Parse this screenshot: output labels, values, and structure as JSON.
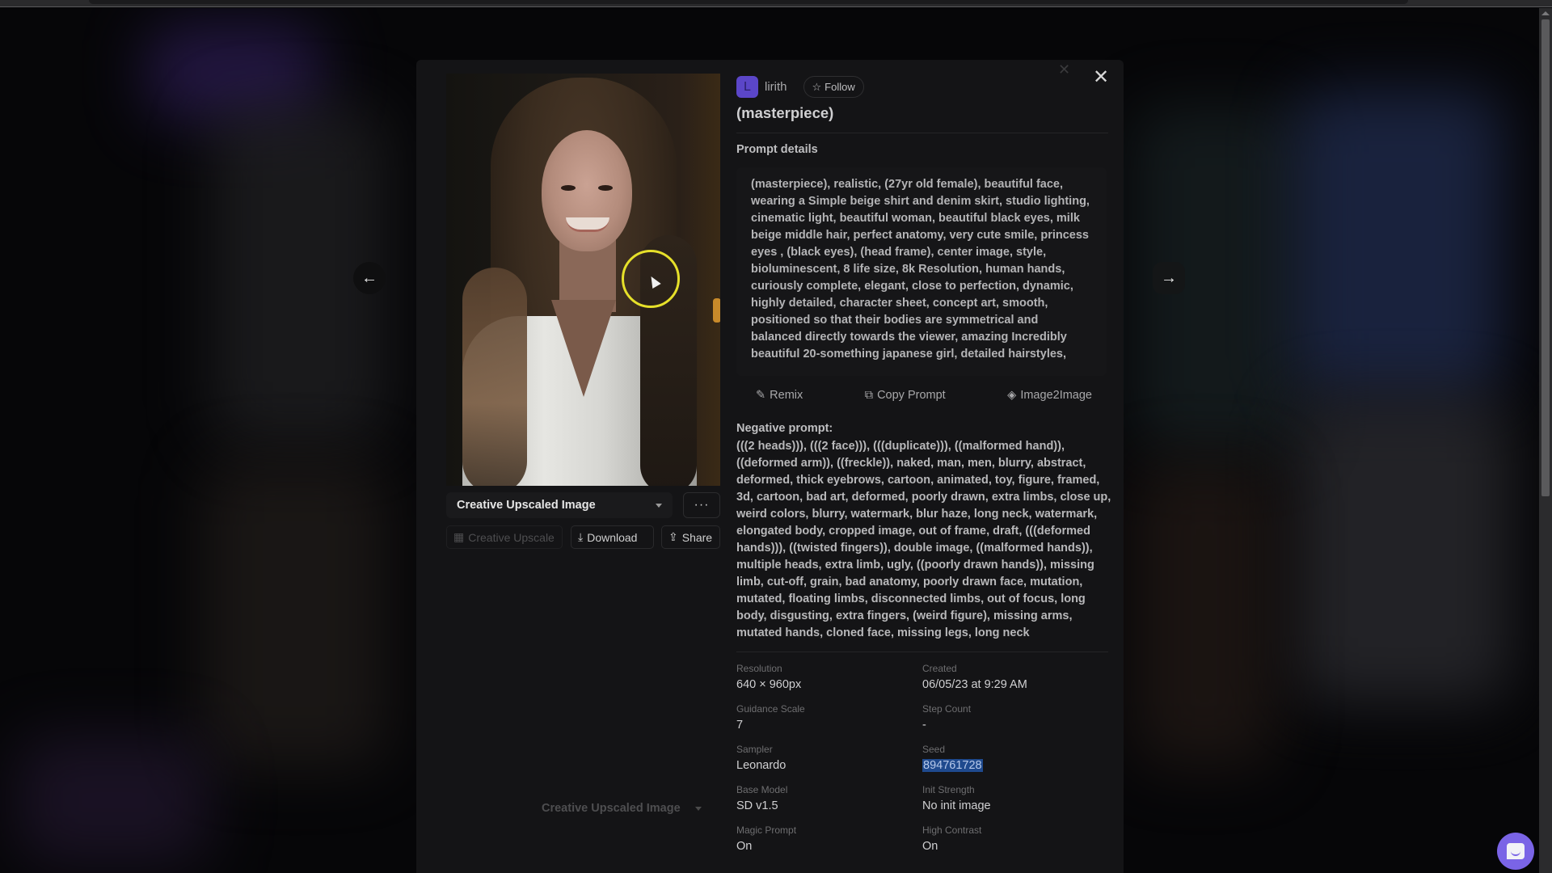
{
  "modal": {
    "author": {
      "avatar_initial": "L",
      "name": "lirith",
      "follow_label": "Follow"
    },
    "title": "(masterpiece)",
    "prompt_details_label": "Prompt details",
    "prompt_text": "(masterpiece), realistic, (27yr old female), beautiful face, wearing a Simple beige shirt and denim skirt, studio lighting, cinematic light, beautiful woman, beautiful black eyes, milk beige middle hair, perfect anatomy, very cute smile, princess eyes , (black eyes), (head frame), center image, style, bioluminescent, 8 life size, 8k Resolution, human hands, curiously complete, elegant, close to perfection, dynamic, highly detailed, character sheet, concept art, smooth, positioned so that their bodies are symmetrical and balanced directly towards the viewer, amazing Incredibly beautiful 20-something japanese girl, detailed hairstyles,",
    "prompt_actions": {
      "remix": "Remix",
      "copy_prompt": "Copy Prompt",
      "image2image": "Image2Image"
    },
    "negative_prompt_label": "Negative prompt:",
    "negative_prompt_text": "(((2 heads))), (((2 face))), (((duplicate))), ((malformed hand)), ((deformed arm)), ((freckle)), naked, man, men, blurry, abstract, deformed, thick eyebrows, cartoon, animated, toy, figure, framed, 3d, cartoon, bad art, deformed, poorly drawn, extra limbs, close up, weird colors, blurry, watermark, blur haze, long neck, watermark, elongated body, cropped image, out of frame, draft, (((deformed hands))), ((twisted fingers)), double image, ((malformed hands)), multiple heads, extra limb, ugly, ((poorly drawn hands)), missing limb, cut-off, grain, bad anatomy, poorly drawn face, mutation, mutated, floating limbs, disconnected limbs, out of focus, long body, disgusting, extra fingers, (weird figure), missing arms, mutated hands, cloned face, missing legs, long neck",
    "metadata": [
      {
        "label": "Resolution",
        "value": "640 × 960px"
      },
      {
        "label": "Created",
        "value": "06/05/23 at 9:29 AM"
      },
      {
        "label": "Guidance Scale",
        "value": "7"
      },
      {
        "label": "Step Count",
        "value": "-"
      },
      {
        "label": "Sampler",
        "value": "Leonardo"
      },
      {
        "label": "Seed",
        "value": "894761728"
      },
      {
        "label": "Base Model",
        "value": "SD v1.5"
      },
      {
        "label": "Init Strength",
        "value": "No init image"
      },
      {
        "label": "Magic Prompt",
        "value": "On"
      },
      {
        "label": "High Contrast",
        "value": "On"
      }
    ],
    "image_controls": {
      "variant_select": "Creative Upscaled Image",
      "more_label": "···",
      "creative_upscale": "Creative Upscale",
      "download": "Download",
      "share": "Share",
      "ghost_select": "Creative Upscaled Image"
    },
    "close_glyph": "✕"
  },
  "colors": {
    "accent": "#7a64e6",
    "avatar": "#5b46c8",
    "selection": "#1f4a8e",
    "cursor_highlight": "#e6e02a"
  }
}
